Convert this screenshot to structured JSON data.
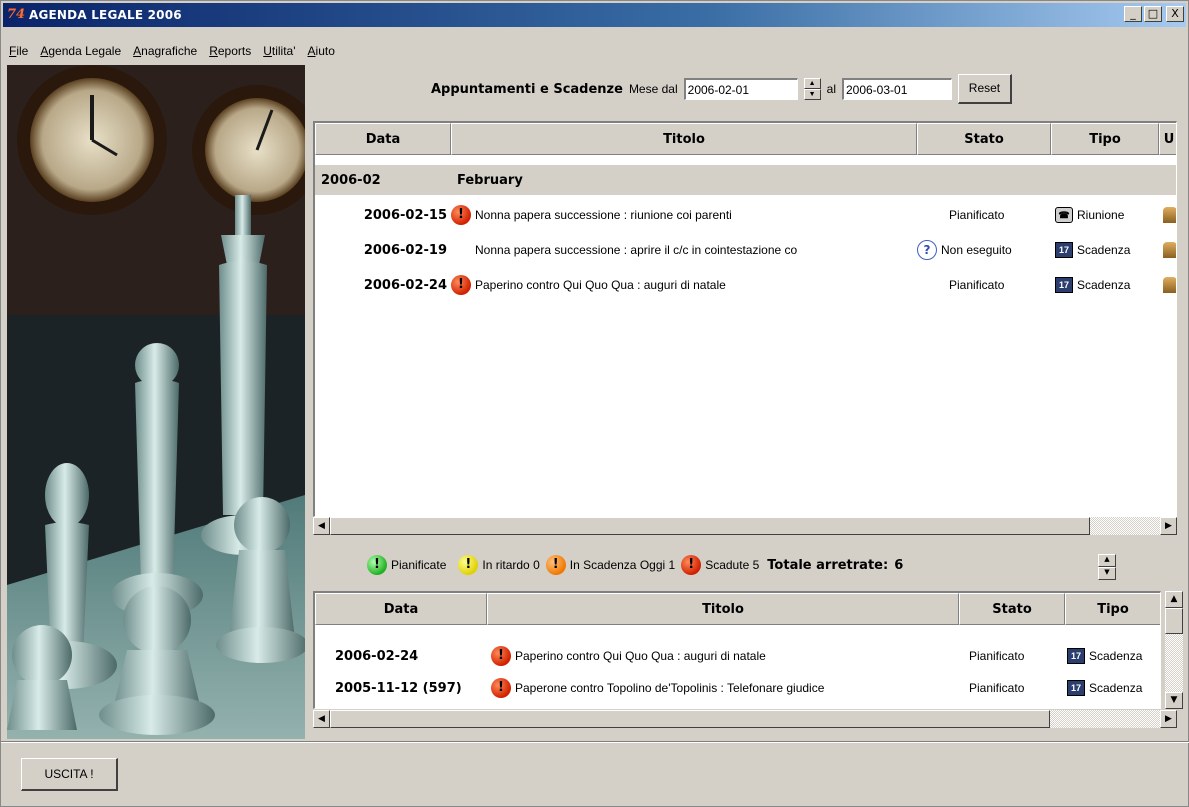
{
  "window": {
    "title": "AGENDA LEGALE 2006",
    "app_icon_text": "74",
    "minimize": "_",
    "maximize": "□",
    "close": "X"
  },
  "menubar": {
    "items": [
      {
        "first": "F",
        "rest": "ile"
      },
      {
        "first": "A",
        "rest": "genda Legale"
      },
      {
        "first": "A",
        "rest": "nagrafiche"
      },
      {
        "first": "R",
        "rest": "eports"
      },
      {
        "first": "U",
        "rest": "tilita'"
      },
      {
        "first": "A",
        "rest": "iuto"
      }
    ]
  },
  "filter": {
    "heading": "Appuntamenti e Scadenze",
    "from_label": "Mese dal",
    "from_value": "2006-02-01",
    "to_label": "al",
    "to_value": "2006-03-01",
    "reset_label": "Reset"
  },
  "top_grid": {
    "columns": [
      "Data",
      "Titolo",
      "Stato",
      "Tipo",
      "U"
    ],
    "group": {
      "date": "2006-02",
      "label": "February"
    },
    "rows": [
      {
        "date": "2006-02-15",
        "priority": "red",
        "title": "Nonna papera successione : riunione coi parenti",
        "status_icon": "",
        "status": "Pianificato",
        "type_icon": "phone",
        "type": "Riunione"
      },
      {
        "date": "2006-02-19",
        "priority": "",
        "title": "Nonna papera successione : aprire il c/c in cointestazione co",
        "status_icon": "question",
        "status": "Non eseguito",
        "type_icon": "calendar",
        "type": "Scadenza"
      },
      {
        "date": "2006-02-24",
        "priority": "red",
        "title": "Paperino contro Qui Quo Qua : auguri di natale",
        "status_icon": "",
        "status": "Pianificato",
        "type_icon": "calendar",
        "type": "Scadenza"
      }
    ]
  },
  "legend": {
    "pianificate": "Pianificate",
    "in_ritardo": "In ritardo",
    "in_ritardo_count": "0",
    "in_scadenza": "In Scadenza Oggi",
    "in_scadenza_count": "1",
    "scadute": "Scadute",
    "scadute_count": "5",
    "totale_label": "Totale arretrate:",
    "totale_count": "6"
  },
  "bottom_grid": {
    "columns": [
      "Data",
      "Titolo",
      "Stato",
      "Tipo"
    ],
    "rows": [
      {
        "date": "2006-02-24",
        "priority": "red",
        "title": "Paperino contro Qui Quo Qua : auguri di natale",
        "status": "Pianificato",
        "type": "Scadenza"
      },
      {
        "date": "2005-11-12 (597)",
        "priority": "red",
        "title": "Paperone contro Topolino de'Topolinis : Telefonare giudice",
        "status": "Pianificato",
        "type": "Scadenza"
      }
    ]
  },
  "exit_button": "USCITA !",
  "colors": {
    "titlebar_start": "#0a246a",
    "titlebar_end": "#a6caf0",
    "window_bg": "#d4d0c8",
    "priority_red": "#d02000"
  }
}
